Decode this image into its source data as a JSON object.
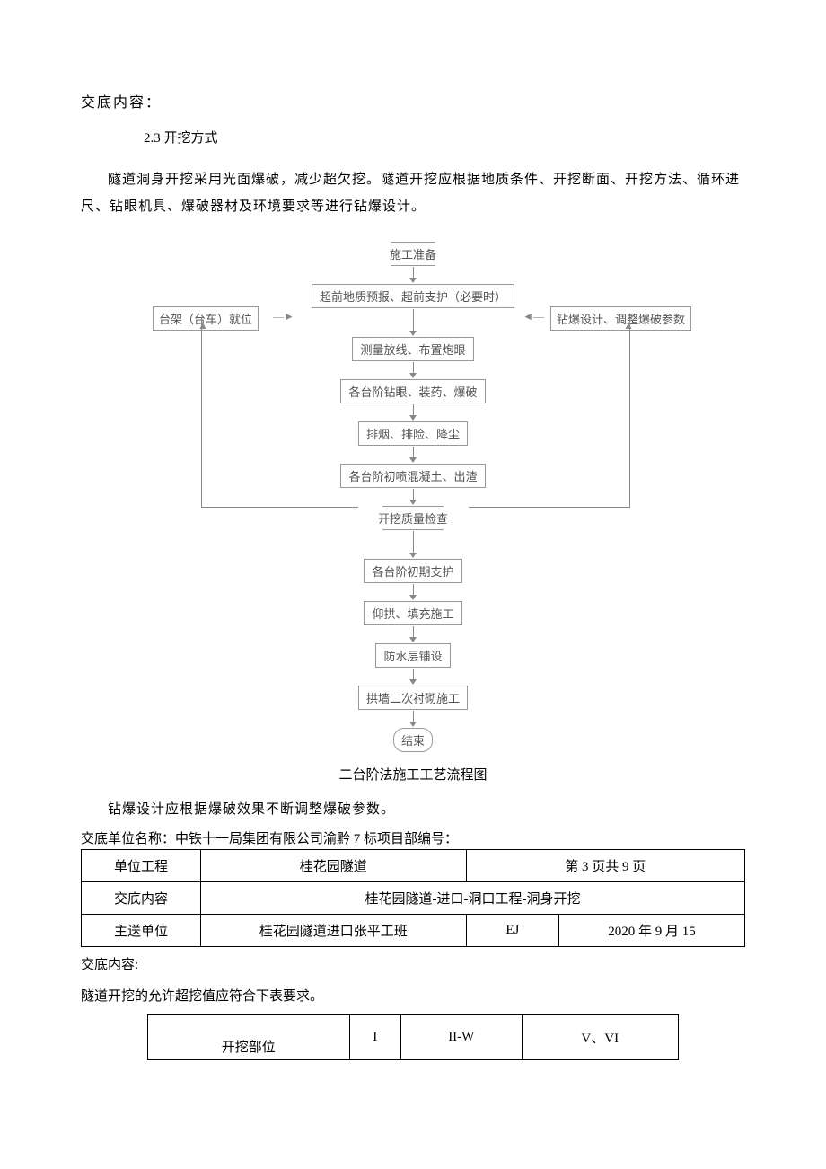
{
  "header": {
    "title": "交底内容：",
    "subtitle": "2.3 开挖方式"
  },
  "body": {
    "p1": "隧道洞身开挖采用光面爆破，减少超欠挖。隧道开挖应根据地质条件、开挖断面、开挖方法、循环进尺、钻眼机具、爆破器材及环境要求等进行钻爆设计。"
  },
  "diagram": {
    "n1": "施工准备",
    "n2": "超前地质预报、超前支护（必要时）",
    "left": "台架（台车）就位",
    "right": "钻爆设计、调整爆破参数",
    "n3": "测量放线、布置炮眼",
    "n4": "各台阶钻眼、装药、爆破",
    "n5": "排烟、排险、降尘",
    "n6": "各台阶初喷混凝土、出渣",
    "n7": "开挖质量检查",
    "n8": "各台阶初期支护",
    "n9": "仰拱、填充施工",
    "n10": "防水层铺设",
    "n11": "拱墙二次衬砌施工",
    "n12": "结束",
    "caption": "二台阶法施工工艺流程图",
    "p2": "钻爆设计应根据爆破效果不断调整爆破参数。"
  },
  "unitLine": "交底单位名称：中铁十一局集团有限公司渝黔 7 标项目部编号：",
  "table1": {
    "r1c1": "单位工程",
    "r1c2": "桂花园隧道",
    "r1c3": "第 3 页共 9 页",
    "r2c1": "交底内容",
    "r2c2": "桂花园隧道-进口-洞口工程-洞身开挖",
    "r3c1": "主送单位",
    "r3c2": "桂花园隧道进口张平工班",
    "r3c3": "EJ",
    "r3c4": "2020 年 9 月 15"
  },
  "after": {
    "l1": "交底内容:",
    "l2": "隧道开挖的允许超挖值应符合下表要求。"
  },
  "table2": {
    "h1": "开挖部位",
    "c1": "I",
    "c2": "II-W",
    "c3": "V、VI"
  },
  "chart_data": {
    "type": "flowchart",
    "title": "二台阶法施工工艺流程图",
    "nodes": [
      {
        "id": "n1",
        "label": "施工准备",
        "shape": "terminator"
      },
      {
        "id": "n2",
        "label": "超前地质预报、超前支护（必要时）",
        "shape": "process"
      },
      {
        "id": "left",
        "label": "台架（台车）就位",
        "shape": "process"
      },
      {
        "id": "right",
        "label": "钻爆设计、调整爆破参数",
        "shape": "process"
      },
      {
        "id": "n3",
        "label": "测量放线、布置炮眼",
        "shape": "process"
      },
      {
        "id": "n4",
        "label": "各台阶钻眼、装药、爆破",
        "shape": "process"
      },
      {
        "id": "n5",
        "label": "排烟、排险、降尘",
        "shape": "process"
      },
      {
        "id": "n6",
        "label": "各台阶初喷混凝土、出渣",
        "shape": "process"
      },
      {
        "id": "n7",
        "label": "开挖质量检查",
        "shape": "decision"
      },
      {
        "id": "n8",
        "label": "各台阶初期支护",
        "shape": "process"
      },
      {
        "id": "n9",
        "label": "仰拱、填充施工",
        "shape": "process"
      },
      {
        "id": "n10",
        "label": "防水层铺设",
        "shape": "process"
      },
      {
        "id": "n11",
        "label": "拱墙二次衬砌施工",
        "shape": "process"
      },
      {
        "id": "n12",
        "label": "结束",
        "shape": "terminator"
      }
    ],
    "edges": [
      {
        "from": "n1",
        "to": "n2"
      },
      {
        "from": "n2",
        "to": "n3"
      },
      {
        "from": "left",
        "to": "n3"
      },
      {
        "from": "right",
        "to": "n3"
      },
      {
        "from": "n3",
        "to": "n4"
      },
      {
        "from": "n4",
        "to": "n5"
      },
      {
        "from": "n5",
        "to": "n6"
      },
      {
        "from": "n6",
        "to": "n7"
      },
      {
        "from": "n7",
        "to": "n8"
      },
      {
        "from": "n7",
        "to": "left",
        "note": "loop-back"
      },
      {
        "from": "n7",
        "to": "right",
        "note": "loop-back"
      },
      {
        "from": "n8",
        "to": "n9"
      },
      {
        "from": "n9",
        "to": "n10"
      },
      {
        "from": "n10",
        "to": "n11"
      },
      {
        "from": "n11",
        "to": "n12"
      }
    ]
  }
}
